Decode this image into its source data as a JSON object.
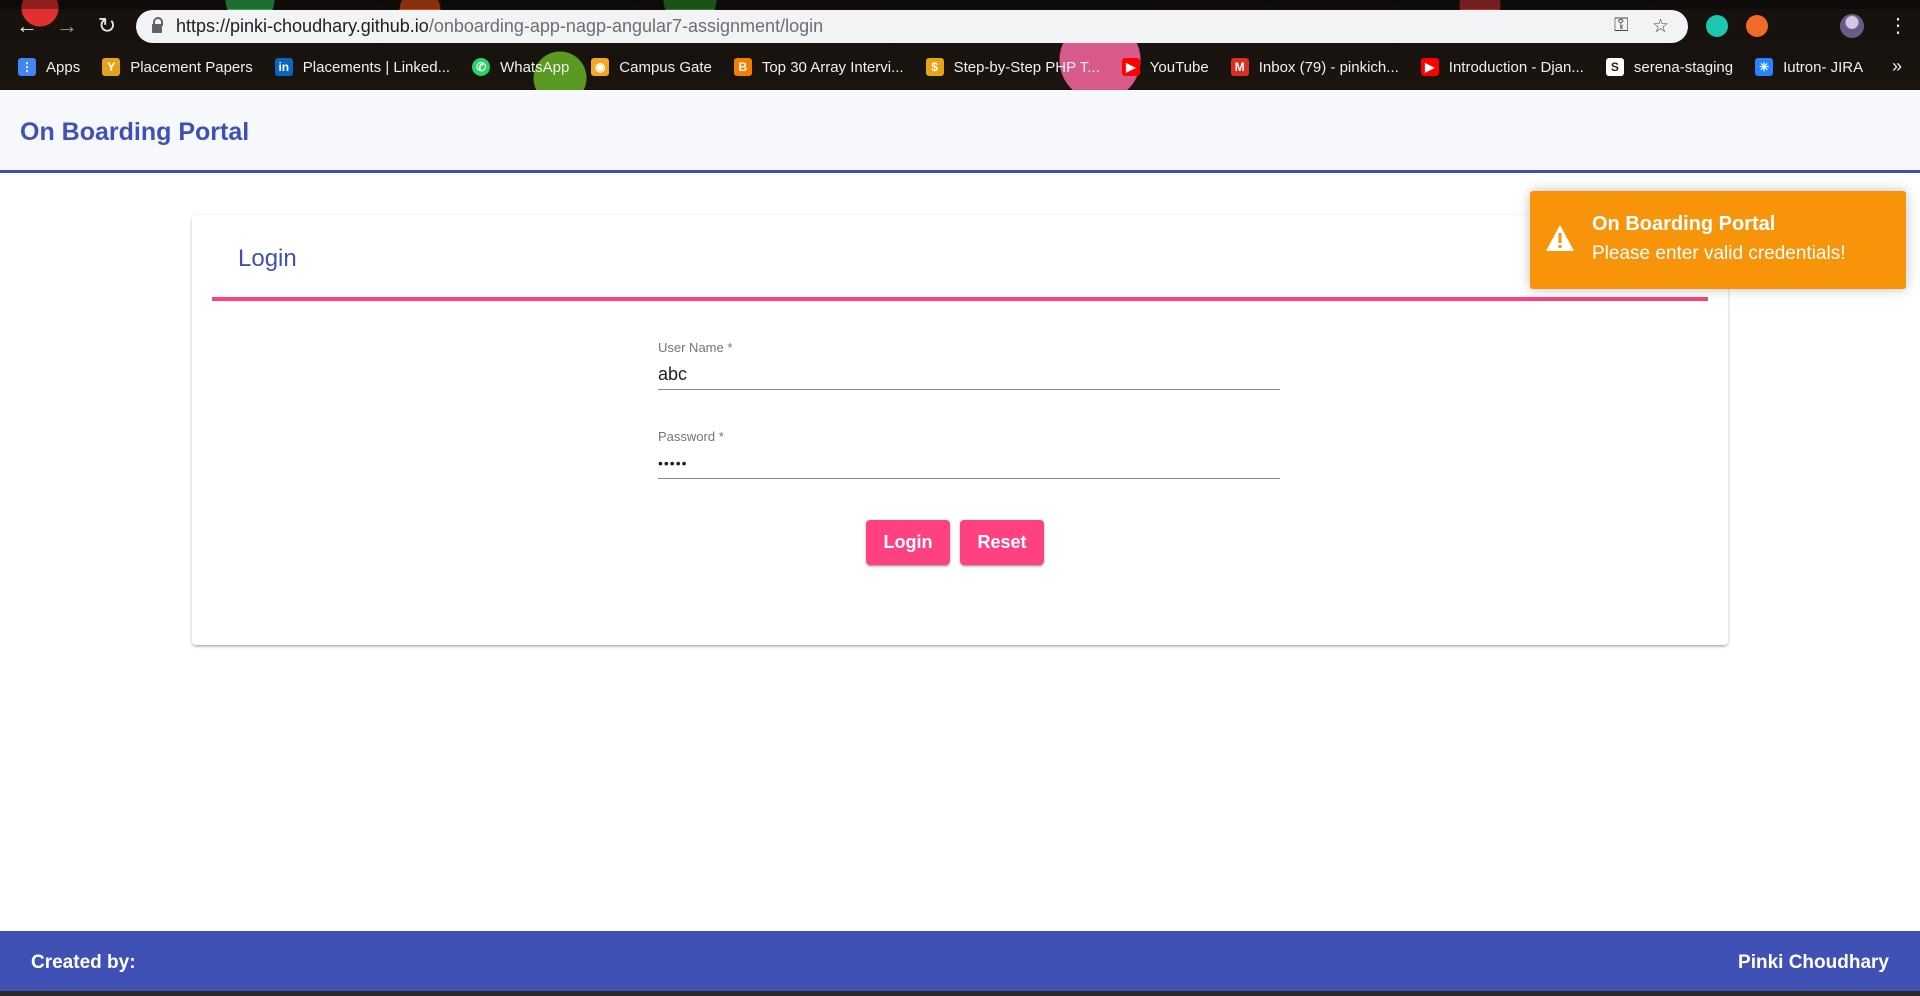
{
  "browser": {
    "url_host": "https://pinki-choudhary.github.io",
    "url_path": "/onboarding-app-nagp-angular7-assignment/login",
    "bookmarks": [
      {
        "label": "Apps",
        "color": "#4285f4"
      },
      {
        "label": "Placement Papers",
        "color": "#e3a21a"
      },
      {
        "label": "Placements | Linked...",
        "color": "#0a66c2"
      },
      {
        "label": "WhatsApp",
        "color": "#25d366"
      },
      {
        "label": "Campus Gate",
        "color": "#f5a623"
      },
      {
        "label": "Top 30 Array Intervi...",
        "color": "#f57d00"
      },
      {
        "label": "Step-by-Step PHP T...",
        "color": "#e8a317"
      },
      {
        "label": "YouTube",
        "color": "#ff0000"
      },
      {
        "label": "Inbox (79) - pinkich...",
        "color": "#d93025"
      },
      {
        "label": "Introduction - Djan...",
        "color": "#ff0000"
      },
      {
        "label": "serena-staging",
        "color": "#ffffff"
      },
      {
        "label": "Iutron- JIRA",
        "color": "#2684ff"
      }
    ],
    "more_glyph": "»"
  },
  "app": {
    "title": "On Boarding Portal"
  },
  "login": {
    "title": "Login",
    "username_label": "User Name *",
    "username_value": "abc",
    "password_label": "Password *",
    "password_value": "•••••",
    "login_button": "Login",
    "reset_button": "Reset",
    "accent_color": "#ff4081"
  },
  "toast": {
    "title": "On Boarding Portal",
    "message": "Please enter valid credentials!",
    "color": "#f7940a"
  },
  "footer": {
    "left": "Created by:",
    "right": "Pinki Choudhary",
    "color": "#3f51b5"
  }
}
